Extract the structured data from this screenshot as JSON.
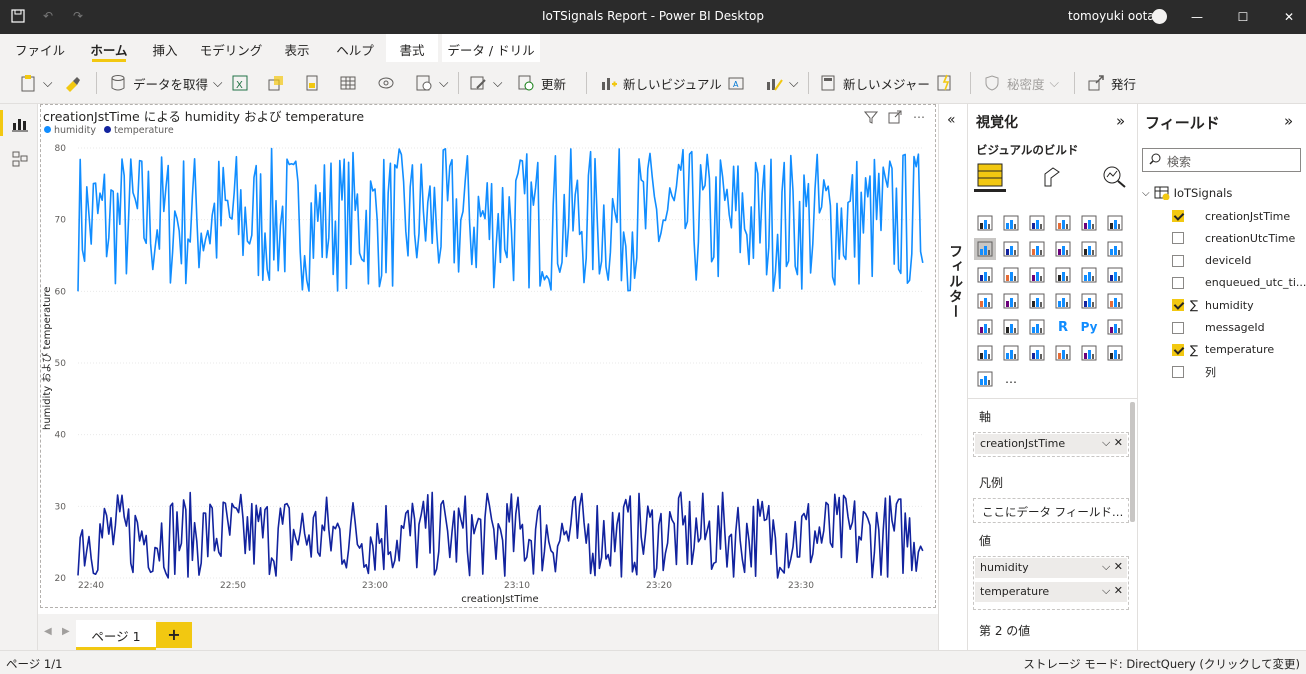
{
  "window": {
    "title": "IoTSignals Report - Power BI Desktop",
    "user": "tomoyuki oota"
  },
  "tabs": [
    "ファイル",
    "ホーム",
    "挿入",
    "モデリング",
    "表示",
    "ヘルプ",
    "書式",
    "データ / ドリル"
  ],
  "ribbon": {
    "get_data": "データを取得",
    "refresh": "更新",
    "new_visual": "新しいビジュアル",
    "new_measure": "新しいメジャー",
    "sensitivity": "秘密度",
    "publish": "発行"
  },
  "visual": {
    "title": "creationJstTime による humidity および temperature",
    "legend": [
      "humidity",
      "temperature"
    ],
    "ylabel": "humidity および temperature",
    "xlabel": "creationJstTime"
  },
  "chart_data": {
    "type": "line",
    "title": "creationJstTime による humidity および temperature",
    "xlabel": "creationJstTime",
    "ylabel": "humidity および temperature",
    "x_ticks": [
      "22:40",
      "22:50",
      "23:00",
      "23:10",
      "23:20",
      "23:30"
    ],
    "y_ticks": [
      20,
      30,
      40,
      50,
      60,
      70,
      80
    ],
    "ylim": [
      20,
      80
    ],
    "x_range": [
      "22:40",
      "23:38"
    ],
    "grid": true,
    "legend_position": "top-left",
    "colors": {
      "humidity": "#118dff",
      "temperature": "#12239e"
    },
    "series": [
      {
        "name": "humidity",
        "range": [
          60,
          80
        ],
        "pattern": "dense noisy oscillation"
      },
      {
        "name": "temperature",
        "range": [
          20,
          32
        ],
        "pattern": "dense noisy oscillation"
      }
    ]
  },
  "pages": {
    "tab": "ページ 1",
    "status": "ページ 1/1"
  },
  "filters_label": "フィルター",
  "viz": {
    "title": "視覚化",
    "subtitle": "ビジュアルのビルド",
    "axis_head": "軸",
    "axis_field": "creationJstTime",
    "legend_head": "凡例",
    "legend_placeholder": "ここにデータ フィールド…",
    "values_head": "値",
    "values": [
      "humidity",
      "temperature"
    ],
    "secondary_head": "第 2 の値",
    "python_label": "Py",
    "r_label": "R",
    "more": "…"
  },
  "fields": {
    "title": "フィールド",
    "search_placeholder": "検索",
    "table": "IoTSignals",
    "items": [
      {
        "name": "creationJstTime",
        "checked": true,
        "sigma": false
      },
      {
        "name": "creationUtcTime",
        "checked": false,
        "sigma": false
      },
      {
        "name": "deviceId",
        "checked": false,
        "sigma": false
      },
      {
        "name": "enqueued_utc_ti...",
        "checked": false,
        "sigma": false
      },
      {
        "name": "humidity",
        "checked": true,
        "sigma": true
      },
      {
        "name": "messageId",
        "checked": false,
        "sigma": false
      },
      {
        "name": "temperature",
        "checked": true,
        "sigma": true
      },
      {
        "name": "列",
        "checked": false,
        "sigma": false
      }
    ]
  },
  "status": {
    "storage": "ストレージ モード: DirectQuery (クリックして変更)"
  }
}
